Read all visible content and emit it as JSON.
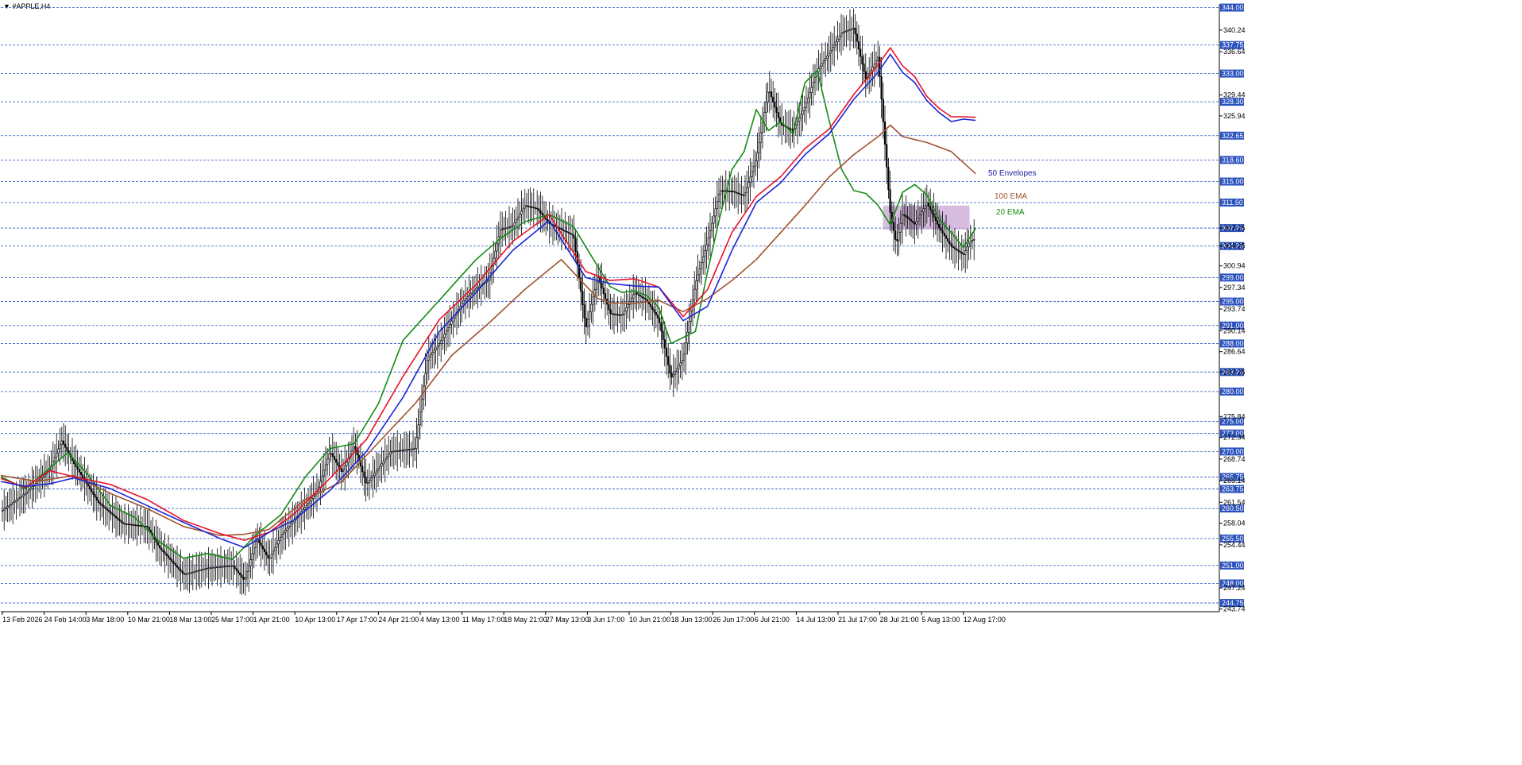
{
  "window": {
    "title": "▼ #APPLE,H4"
  },
  "annotations": {
    "envelopes": {
      "text": "50 Envelopes",
      "color": "#1a1aa6"
    },
    "ema100": {
      "text": "100 EMA",
      "color": "#a0522d"
    },
    "ema20": {
      "text": "20 EMA",
      "color": "#138a13"
    }
  },
  "colors": {
    "axis": "#000000",
    "hline": "#2a52be",
    "price_tag_bg": "#2a52be",
    "ema20": "#138a13",
    "ema100": "#a0522d",
    "env_upper": "#e8102a",
    "env_lower": "#1a24d6",
    "zone": "#c8a6d4",
    "candle": "#000000"
  },
  "chart_data": {
    "type": "line",
    "title": "#APPLE,H4",
    "xlabel": "",
    "ylabel": "",
    "ylim": [
      243.3,
      344.6
    ],
    "grid": false,
    "x_tick_labels": [
      "13 Feb 2026",
      "24 Feb 14:00",
      "3 Mar 18:00",
      "10 Mar 21:00",
      "18 Mar 13:00",
      "25 Mar 17:00",
      "1 Apr 21:00",
      "10 Apr 13:00",
      "17 Apr 17:00",
      "24 Apr 21:00",
      "4 May 13:00",
      "11 May 17:00",
      "18 May 21:00",
      "27 May 13:00",
      "3 Jun 17:00",
      "10 Jun 21:00",
      "18 Jun 13:00",
      "26 Jun 17:00",
      "6 Jul 21:00",
      "14 Jul 13:00",
      "21 Jul 17:00",
      "28 Jul 21:00",
      "5 Aug 13:00",
      "12 Aug 17:00"
    ],
    "y_tick_labels": [
      "340.24",
      "336.64",
      "329.44",
      "325.94",
      "300.94",
      "297.34",
      "293.74",
      "286.64",
      "268.74",
      "261.54",
      "258.04",
      "254.44",
      "247.24",
      "243.74",
      "304.25",
      "307.25",
      "283.25",
      "275.84",
      "272.34",
      "265.14",
      "290.14"
    ],
    "horizontal_levels": [
      "344.00",
      "337.75",
      "333.00",
      "328.30",
      "322.65",
      "318.60",
      "315.00",
      "311.50",
      "307.25",
      "304.25",
      "299.00",
      "295.00",
      "291.00",
      "288.00",
      "283.25",
      "280.00",
      "275.00",
      "273.00",
      "270.00",
      "265.75",
      "263.75",
      "260.50",
      "255.50",
      "251.00",
      "248.00",
      "244.75"
    ],
    "zone": {
      "x_start": 0.724,
      "x_end": 0.795,
      "y_low": 307.0,
      "y_high": 311.0
    },
    "series": [
      {
        "name": "20 EMA",
        "type": "line",
        "x": [
          0,
          0.02,
          0.04,
          0.055,
          0.07,
          0.09,
          0.11,
          0.13,
          0.15,
          0.17,
          0.19,
          0.21,
          0.23,
          0.25,
          0.27,
          0.29,
          0.31,
          0.33,
          0.35,
          0.37,
          0.39,
          0.41,
          0.43,
          0.45,
          0.47,
          0.49,
          0.5,
          0.51,
          0.52,
          0.53,
          0.54,
          0.55,
          0.57,
          0.58,
          0.59,
          0.6,
          0.61,
          0.62,
          0.63,
          0.64,
          0.65,
          0.66,
          0.67,
          0.68,
          0.69,
          0.7,
          0.71,
          0.72,
          0.73,
          0.74,
          0.75,
          0.76,
          0.77,
          0.78,
          0.79,
          0.8
        ],
        "y": [
          265.8,
          263.8,
          267.2,
          269.8,
          266.5,
          261,
          259,
          255,
          252.2,
          253,
          252,
          256.2,
          259.5,
          265.8,
          270.5,
          271.3,
          278,
          288.5,
          293,
          297.5,
          302,
          305.5,
          308.3,
          309.5,
          307.5,
          300.8,
          297.5,
          296.5,
          296.8,
          296,
          294,
          288,
          290,
          300,
          309,
          317,
          320,
          327,
          323.5,
          325,
          323,
          331.5,
          333.5,
          325,
          317,
          313.5,
          313,
          311,
          307.8,
          313.2,
          314.5,
          312.8,
          308.7,
          306.5,
          304,
          307.2
        ]
      },
      {
        "name": "100 EMA",
        "type": "line",
        "x": [
          0,
          0.03,
          0.06,
          0.09,
          0.12,
          0.15,
          0.18,
          0.2,
          0.22,
          0.25,
          0.28,
          0.31,
          0.34,
          0.37,
          0.4,
          0.43,
          0.46,
          0.49,
          0.5,
          0.52,
          0.54,
          0.56,
          0.58,
          0.6,
          0.62,
          0.64,
          0.66,
          0.68,
          0.7,
          0.72,
          0.73,
          0.74,
          0.76,
          0.78,
          0.8
        ],
        "y": [
          266,
          265,
          266,
          263,
          260.5,
          257.5,
          256,
          256.2,
          257,
          262,
          265,
          271.5,
          278,
          286,
          291.3,
          297,
          302,
          295.5,
          294.8,
          294.7,
          295.2,
          293.3,
          295.5,
          298.5,
          302,
          306.5,
          311,
          315.8,
          319.5,
          322.5,
          324.4,
          322.5,
          321.5,
          320,
          316.3
        ]
      },
      {
        "name": "Envelope upper",
        "type": "line",
        "x": [
          0,
          0.02,
          0.04,
          0.06,
          0.09,
          0.12,
          0.15,
          0.18,
          0.2,
          0.22,
          0.24,
          0.27,
          0.3,
          0.33,
          0.36,
          0.39,
          0.42,
          0.45,
          0.48,
          0.5,
          0.52,
          0.54,
          0.56,
          0.58,
          0.6,
          0.62,
          0.64,
          0.66,
          0.68,
          0.7,
          0.72,
          0.73,
          0.74,
          0.75,
          0.76,
          0.77,
          0.78,
          0.79,
          0.8
        ],
        "y": [
          265.5,
          264,
          266.8,
          265.8,
          264.5,
          262,
          258.5,
          256.3,
          255.2,
          256.5,
          259.5,
          265.5,
          272,
          282.5,
          292,
          297.8,
          305,
          309.5,
          300,
          298.5,
          298.8,
          297.4,
          292.5,
          297,
          306.5,
          312.5,
          315.8,
          320.5,
          323.8,
          329.5,
          334.5,
          337.3,
          334.3,
          332.5,
          329.2,
          327.2,
          325.8,
          325.8,
          325.7
        ]
      },
      {
        "name": "Envelope lower",
        "type": "line",
        "x": [
          0,
          0.02,
          0.04,
          0.06,
          0.09,
          0.12,
          0.15,
          0.18,
          0.2,
          0.22,
          0.24,
          0.27,
          0.3,
          0.33,
          0.36,
          0.39,
          0.42,
          0.45,
          0.48,
          0.5,
          0.52,
          0.54,
          0.56,
          0.58,
          0.6,
          0.62,
          0.64,
          0.66,
          0.68,
          0.7,
          0.72,
          0.73,
          0.74,
          0.75,
          0.76,
          0.77,
          0.78,
          0.79,
          0.8
        ],
        "y": [
          265,
          264.2,
          264.6,
          265.6,
          263.8,
          261,
          258.2,
          255.5,
          254,
          256.5,
          258.5,
          263.5,
          270,
          279,
          290,
          296.5,
          303.5,
          308.5,
          299,
          298,
          297.6,
          297.4,
          291.8,
          294.2,
          303.5,
          311.5,
          314.8,
          319.5,
          323,
          328.7,
          333.2,
          336.2,
          333.2,
          331.5,
          328.5,
          326.5,
          325,
          325.4,
          325.2
        ]
      },
      {
        "name": "Price",
        "type": "candles_path",
        "x": [
          0,
          0.02,
          0.04,
          0.05,
          0.06,
          0.08,
          0.1,
          0.12,
          0.13,
          0.15,
          0.17,
          0.19,
          0.2,
          0.21,
          0.22,
          0.23,
          0.25,
          0.26,
          0.27,
          0.28,
          0.29,
          0.3,
          0.32,
          0.34,
          0.35,
          0.36,
          0.37,
          0.38,
          0.39,
          0.4,
          0.41,
          0.42,
          0.43,
          0.44,
          0.45,
          0.46,
          0.47,
          0.48,
          0.49,
          0.5,
          0.51,
          0.52,
          0.53,
          0.54,
          0.55,
          0.56,
          0.57,
          0.58,
          0.59,
          0.6,
          0.61,
          0.62,
          0.63,
          0.64,
          0.65,
          0.66,
          0.67,
          0.68,
          0.69,
          0.7,
          0.71,
          0.72,
          0.73,
          0.735,
          0.74,
          0.75,
          0.76,
          0.77,
          0.78,
          0.79,
          0.795,
          0.8
        ],
        "y": [
          260,
          263,
          267,
          271.8,
          268,
          261.5,
          258,
          257.5,
          254,
          249.5,
          250.6,
          251,
          248.5,
          255.5,
          252,
          256,
          260.8,
          263.5,
          270,
          266.5,
          271,
          264.5,
          270,
          270.5,
          285.5,
          288,
          291.8,
          295.2,
          297.2,
          298.6,
          307,
          307.6,
          311,
          310.5,
          308,
          307,
          306,
          290.5,
          299.2,
          293,
          292.7,
          296.5,
          295.2,
          292,
          282.2,
          285.5,
          298,
          305,
          313.5,
          313.4,
          312.6,
          318.8,
          330.5,
          324.5,
          323.5,
          327.5,
          333.5,
          336.5,
          339.8,
          340.6,
          331.9,
          335.8,
          309.5,
          304.5,
          309.6,
          307.9,
          311.5,
          307.3,
          304.2,
          302.8,
          305,
          305.5
        ]
      }
    ]
  }
}
